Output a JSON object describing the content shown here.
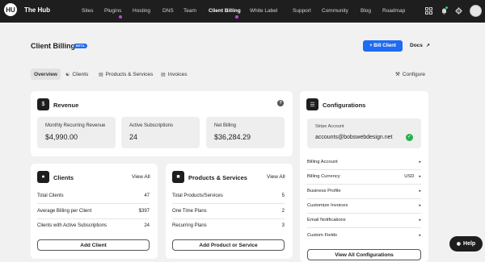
{
  "brand": {
    "logo_text": "HU",
    "name": "The Hub"
  },
  "nav": {
    "items": [
      {
        "label": "Sites"
      },
      {
        "label": "Plugins"
      },
      {
        "label": "Hosting"
      },
      {
        "label": "DNS"
      },
      {
        "label": "Team"
      },
      {
        "label": "Client Billing"
      },
      {
        "label": "White Label"
      },
      {
        "label": "Support"
      },
      {
        "label": "Community"
      },
      {
        "label": "Blog"
      },
      {
        "label": "Roadmap"
      }
    ],
    "active": "Client Billing",
    "icons": [
      "grid-icon",
      "notification-icon",
      "settings-icon"
    ]
  },
  "header": {
    "title": "Client Billing",
    "badge": "BETA",
    "bill_button": "+ Bill Client",
    "docs": "Docs"
  },
  "tabs": [
    {
      "label": "Overview",
      "icon": ""
    },
    {
      "label": "Clients",
      "icon": "users-icon"
    },
    {
      "label": "Products & Services",
      "icon": "box-icon"
    },
    {
      "label": "Invoices",
      "icon": "invoice-icon"
    }
  ],
  "configure": "Configure",
  "revenue": {
    "title": "Revenue",
    "stats": [
      {
        "label": "Monthly Recurring Revenue",
        "value": "$4,990.00"
      },
      {
        "label": "Active Subscriptions",
        "value": "24"
      },
      {
        "label": "Net Billing",
        "value": "$36,284.29"
      }
    ]
  },
  "clients": {
    "title": "Clients",
    "view_all": "View All",
    "rows": [
      {
        "label": "Total Clients",
        "value": "47"
      },
      {
        "label": "Average Billing per Client",
        "value": "$397"
      },
      {
        "label": "Clients with Active Subscriptions",
        "value": "24"
      }
    ],
    "button": "Add Client"
  },
  "products": {
    "title": "Products & Services",
    "view_all": "View All",
    "rows": [
      {
        "label": "Total Products/Services",
        "value": "5"
      },
      {
        "label": "One Time Plans",
        "value": "2"
      },
      {
        "label": "Recurring Plans",
        "value": "3"
      }
    ],
    "button": "Add Product or Service"
  },
  "configurations": {
    "title": "Configurations",
    "stripe_label": "Stripe Account",
    "stripe_value": "accounts@bobswebdesign.net",
    "items": [
      {
        "label": "Billing Account",
        "value": ""
      },
      {
        "label": "Billing Currency",
        "value": "USD"
      },
      {
        "label": "Business Profile",
        "value": ""
      },
      {
        "label": "Customize Invoices",
        "value": ""
      },
      {
        "label": "Email Notifications",
        "value": ""
      },
      {
        "label": "Custom Fields",
        "value": ""
      }
    ],
    "button": "View All Configurations"
  },
  "help": "Help",
  "colors": {
    "nav_bg": "#1e1e1e",
    "accent": "#1f6bf1",
    "page_bg": "#f1f1f1",
    "success": "#24b24a",
    "nav_dot": "#b84ad6"
  }
}
